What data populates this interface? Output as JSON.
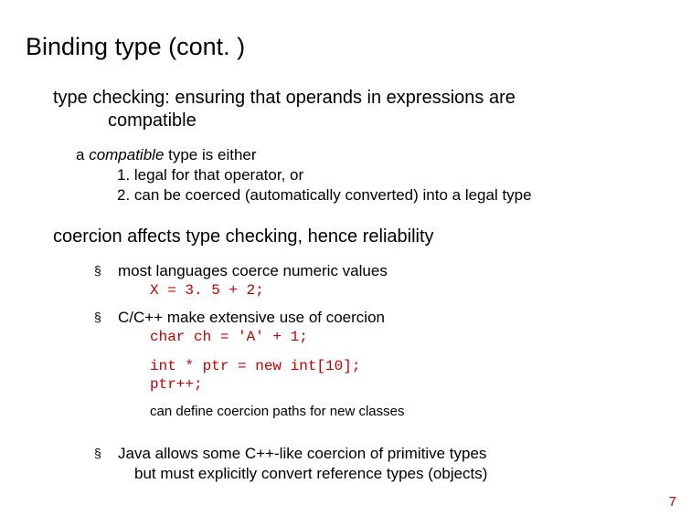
{
  "title": "Binding type (cont. )",
  "p1": {
    "line1": "type checking: ensuring that operands in expressions are",
    "line2": "compatible"
  },
  "p2": {
    "prefix": "a ",
    "italic": "compatible",
    "suffix": " type is either",
    "item1": "1.  legal for that operator, or",
    "item2": "2.  can be coerced (automatically converted) into a legal type"
  },
  "p3": "coercion affects type checking, hence reliability",
  "b1": {
    "text": "most languages coerce numeric values",
    "code": "X = 3. 5 + 2;"
  },
  "b2": {
    "text": "C/C++ make extensive use of coercion",
    "code1": "char ch = 'A' + 1;",
    "code2": "int * ptr = new int[10];",
    "code3": "ptr++;",
    "note": "can define coercion paths for new classes"
  },
  "b3": {
    "line1": "Java allows some C++-like coercion of primitive types",
    "line2": "but must explicitly convert reference types (objects)"
  },
  "bullet": "§",
  "page": "7"
}
